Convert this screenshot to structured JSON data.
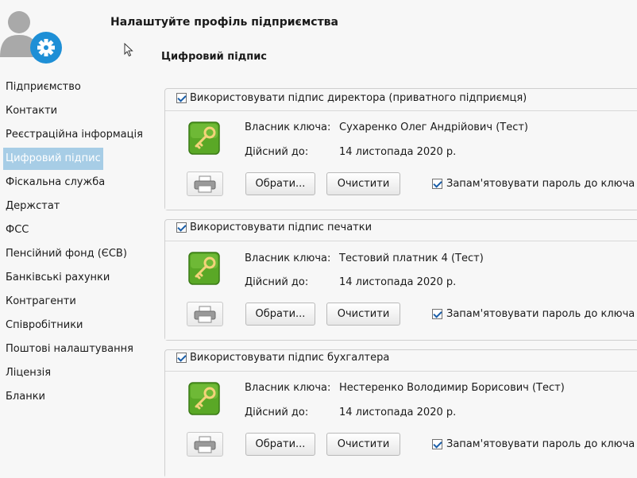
{
  "header": {
    "title": "Налаштуйте профіль підприємства",
    "section_title": "Цифровий підпис"
  },
  "sidebar": {
    "items": [
      {
        "label": "Підприємство"
      },
      {
        "label": "Контакти"
      },
      {
        "label": "Реєстраційна інформація"
      },
      {
        "label": "Цифровий підпис",
        "active": true
      },
      {
        "label": "Фіскальна служба"
      },
      {
        "label": "Держстат"
      },
      {
        "label": "ФСС"
      },
      {
        "label": "Пенсійний фонд (ЄСВ)"
      },
      {
        "label": "Банківські рахунки"
      },
      {
        "label": "Контрагенти"
      },
      {
        "label": "Співробітники"
      },
      {
        "label": "Поштові налаштування"
      },
      {
        "label": "Ліцензія"
      },
      {
        "label": "Бланки"
      }
    ]
  },
  "groups": [
    {
      "checkbox_label": "Використовувати підпис директора (приватного підприємця)",
      "checked": true,
      "owner_label": "Власник ключа:",
      "owner_value": "Сухаренко Олег Андрійович (Тест)",
      "valid_label": "Дійсний до:",
      "valid_value": "14 листопада 2020 р.",
      "choose_button": "Обрати...",
      "clear_button": "Очистити",
      "remember_label": "Запам'ятовувати пароль до ключа",
      "remember_checked": true
    },
    {
      "checkbox_label": "Використовувати підпис печатки",
      "checked": true,
      "owner_label": "Власник ключа:",
      "owner_value": "Тестовий платник 4 (Тест)",
      "valid_label": "Дійсний до:",
      "valid_value": "14 листопада 2020 р.",
      "choose_button": "Обрати...",
      "clear_button": "Очистити",
      "remember_label": "Запам'ятовувати пароль до ключа",
      "remember_checked": true
    },
    {
      "checkbox_label": "Використовувати підпис бухгалтера",
      "checked": true,
      "owner_label": "Власник ключа:",
      "owner_value": "Нестеренко Володимир Борисович (Тест)",
      "valid_label": "Дійсний до:",
      "valid_value": "14 листопада 2020 р.",
      "choose_button": "Обрати...",
      "clear_button": "Очистити",
      "remember_label": "Запам'ятовувати пароль до ключа",
      "remember_checked": true
    }
  ],
  "icons": {
    "profile": "user-gear-icon",
    "key": "key-icon",
    "print": "printer-icon"
  },
  "colors": {
    "sidebar_active": "#a7cde6",
    "gear_blue": "#1e8fd6",
    "key_green": "#5aa826"
  }
}
